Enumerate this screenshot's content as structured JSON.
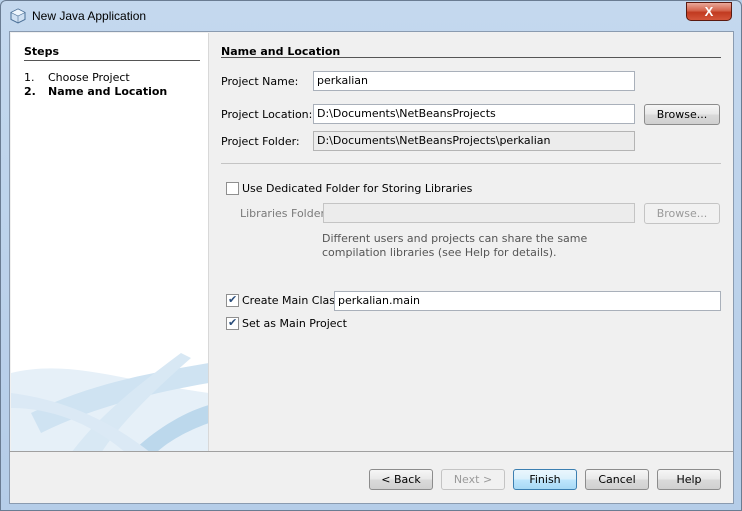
{
  "window": {
    "title": "New Java Application",
    "close_label": "X"
  },
  "steps": {
    "title": "Steps",
    "items": [
      {
        "num": "1.",
        "label": "Choose Project"
      },
      {
        "num": "2.",
        "label": "Name and Location"
      }
    ]
  },
  "form": {
    "section_title": "Name and Location",
    "project_name": {
      "label": "Project Name:",
      "value": "perkalian"
    },
    "project_location": {
      "label": "Project Location:",
      "value": "D:\\Documents\\NetBeansProjects",
      "browse": "Browse..."
    },
    "project_folder": {
      "label": "Project Folder:",
      "value": "D:\\Documents\\NetBeansProjects\\perkalian"
    },
    "dedicated_folder": {
      "label": "Use Dedicated Folder for Storing Libraries",
      "checked": false
    },
    "libraries_folder": {
      "label": "Libraries Folder:",
      "value": "",
      "browse": "Browse..."
    },
    "libraries_note": "Different users and projects can share the same compilation libraries (see Help for details).",
    "create_main_class": {
      "label": "Create Main Class",
      "value": "perkalian.main",
      "checked": true
    },
    "set_main_project": {
      "label": "Set as Main Project",
      "checked": true
    }
  },
  "buttons": {
    "back": "< Back",
    "next": "Next >",
    "finish": "Finish",
    "cancel": "Cancel",
    "help": "Help"
  },
  "colors": {
    "default_button_border": "#3c7fb1",
    "window_frame": "#b9d1ea"
  }
}
